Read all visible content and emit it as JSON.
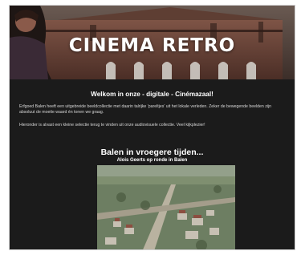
{
  "header": {
    "title": "CINEMA RETRO"
  },
  "intro": {
    "heading": "Welkom in onze - digitale - Cinémazaal!",
    "paragraph1": "Erfgoed Balen heeft een uitgebreide beeldcollectie met daarin talrijke 'pareltjes' uit het lokale verleden. Zeker de bewegende beelden zijn absoluut de moeite waard én tonen we graag.",
    "paragraph2": "Hieronder is alvast een kleine selectie terug te vinden uit onze audiovisuele collectie. Veel kijkplezier!"
  },
  "section": {
    "title": "Balen in vroegere tijden...",
    "subtitle": "Alois Geerts op ronde in Balen"
  },
  "colors": {
    "background": "#1b1b1b",
    "text": "#ffffff"
  }
}
